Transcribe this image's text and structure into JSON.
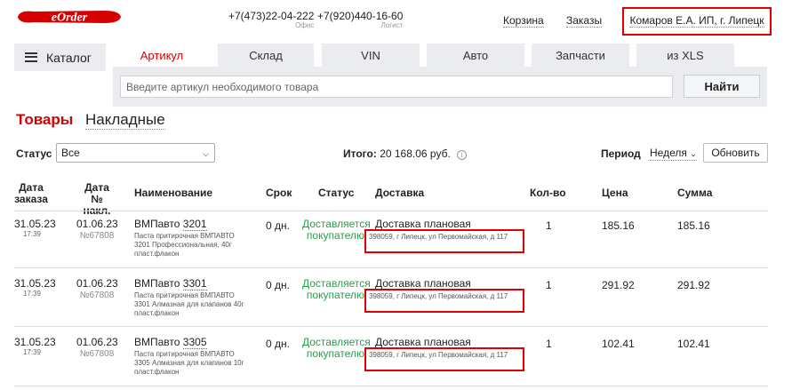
{
  "header": {
    "logo_text": "eOrder",
    "phone1": "+7(473)22-04-222",
    "phone1_caption": "Офис",
    "phone2": "+7(920)440-16-60",
    "phone2_caption": "Логист",
    "cart_link": "Корзина",
    "orders_link": "Заказы",
    "user": "Комаров Е.А. ИП, г. Липецк"
  },
  "nav": {
    "catalog_label": "Каталог",
    "tabs": [
      "Артикул",
      "Склад",
      "VIN",
      "Авто",
      "Запчасти",
      "из XLS"
    ]
  },
  "search": {
    "placeholder": "Введите артикул необходимого товара",
    "button": "Найти"
  },
  "sections": [
    "Товары",
    "Накладные"
  ],
  "filters": {
    "status_label": "Статус",
    "status_value": "Все",
    "total_label": "Итого:",
    "total_value": "20 168.06 руб.",
    "period_label": "Период",
    "period_value": "Неделя",
    "refresh_button": "Обновить"
  },
  "table": {
    "headers": {
      "order_date_1": "Дата",
      "order_date_2": "заказа",
      "inv_date_1": "Дата",
      "inv_date_2": "№ накл.",
      "name": "Наименование",
      "term": "Срок",
      "status": "Статус",
      "delivery": "Доставка",
      "qty": "Кол-во",
      "price": "Цена",
      "sum": "Сумма"
    },
    "rows": [
      {
        "order_date": "31.05.23",
        "order_time": "17:39",
        "inv_date": "01.06.23",
        "inv_no": "№67808",
        "brand": "ВМПавто",
        "code": "3201",
        "desc": "Паста притирочная ВМПАВТО 3201 Профессиональная, 40г пласт.флакон",
        "term": "0 дн.",
        "status_1": "Доставляется",
        "status_2": "покупателю",
        "delivery": "Доставка плановая",
        "address": "398059, г Липецк, ул Первомайская, д 117",
        "qty": "1",
        "price": "185.16",
        "sum": "185.16"
      },
      {
        "order_date": "31.05.23",
        "order_time": "17:39",
        "inv_date": "01.06.23",
        "inv_no": "№67808",
        "brand": "ВМПавто",
        "code": "3301",
        "desc": "Паста притирочная ВМПАВТО 3301 Алмазная для клапанов 40г пласт.флакон",
        "term": "0 дн.",
        "status_1": "Доставляется",
        "status_2": "покупателю",
        "delivery": "Доставка плановая",
        "address": "398059, г Липецк, ул Первомайская, д 117",
        "qty": "1",
        "price": "291.92",
        "sum": "291.92"
      },
      {
        "order_date": "31.05.23",
        "order_time": "17:39",
        "inv_date": "01.06.23",
        "inv_no": "№67808",
        "brand": "ВМПавто",
        "code": "3305",
        "desc": "Паста притирочная ВМПАВТО 3305 Алмазная для клапанов 10г пласт.флакон",
        "term": "0 дн.",
        "status_1": "Доставляется",
        "status_2": "покупателю",
        "delivery": "Доставка плановая",
        "address": "398059, г Липецк, ул Первомайская, д 117",
        "qty": "1",
        "price": "102.41",
        "sum": "102.41"
      }
    ]
  },
  "colors": {
    "brand_red": "#d60000",
    "status_green": "#2a9d4a",
    "highlight_border": "#e00000",
    "tab_bg": "#eaecef"
  }
}
